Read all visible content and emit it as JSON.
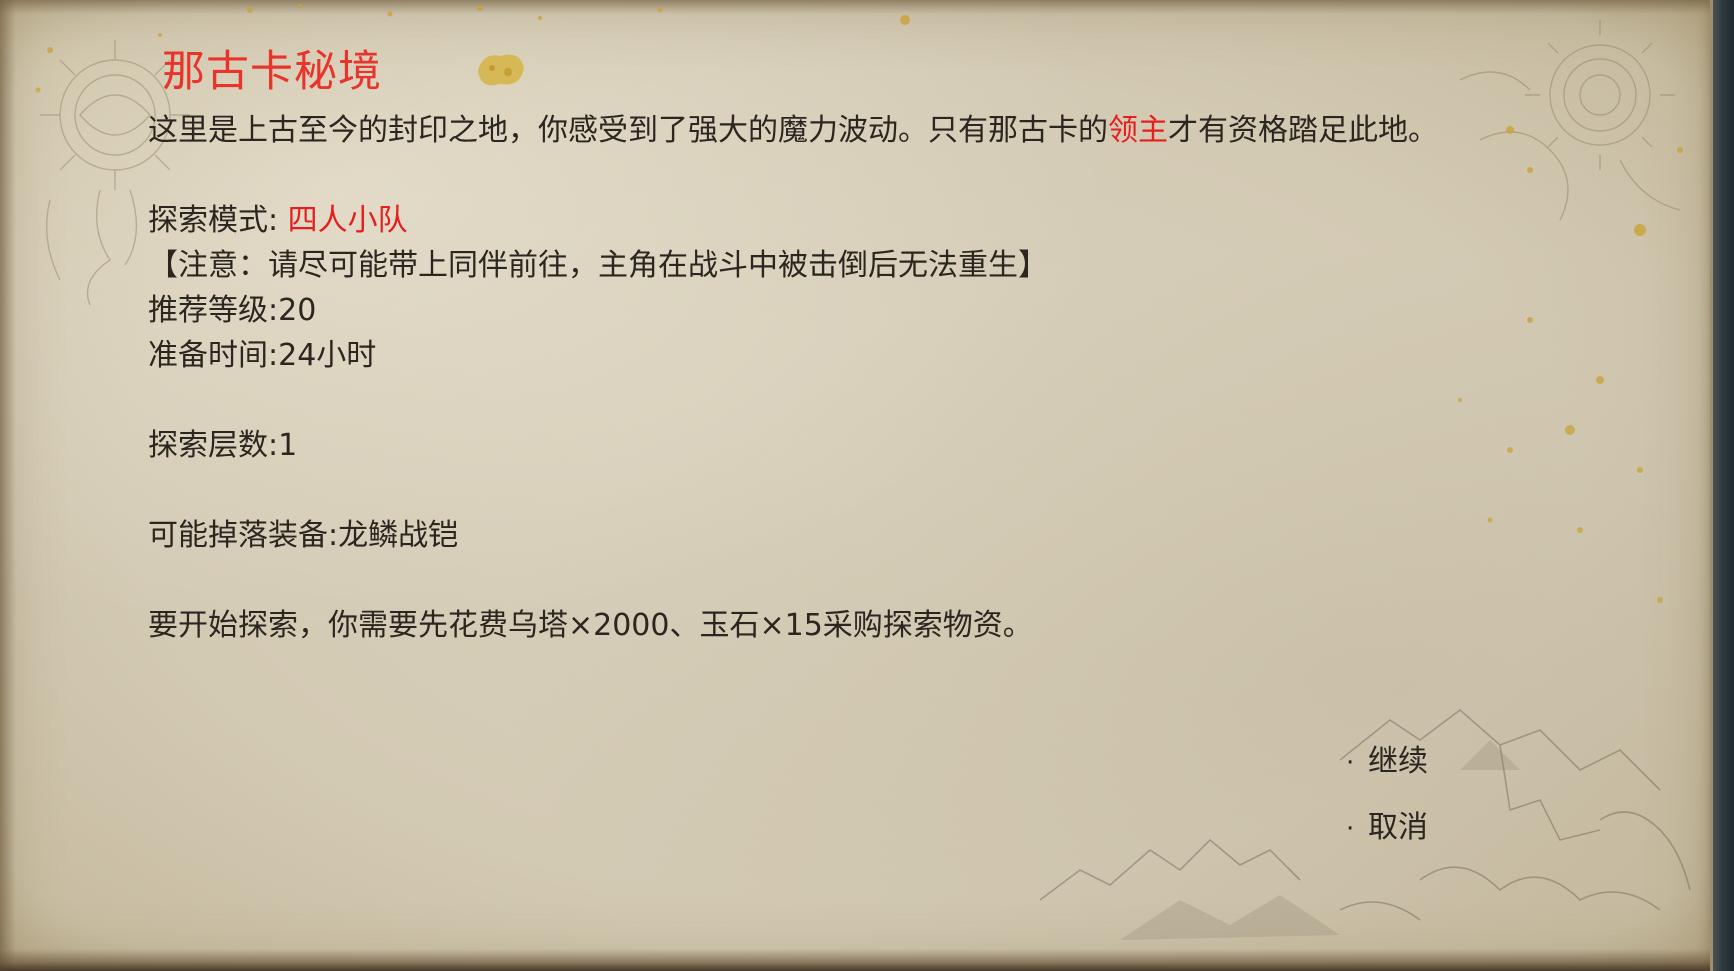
{
  "dialog": {
    "title": "那古卡秘境",
    "description": {
      "before": "这里是上古至今的封印之地，你感受到了强大的魔力波动。只有那古卡的",
      "highlight": "领主",
      "after": "才有资格踏足此地。"
    },
    "mode": {
      "label": "探索模式: ",
      "value": "四人小队"
    },
    "notice": "【注意：请尽可能带上同伴前往，主角在战斗中被击倒后无法重生】",
    "recommended_level": "推荐等级:20",
    "prep_time": "准备时间:24小时",
    "floors": "探索层数:1",
    "drops": "可能掉落装备:龙鳞战铠",
    "cost": "要开始探索，你需要先花费乌塔×2000、玉石×15采购探索物资。"
  },
  "options": {
    "bullet": "·",
    "continue_label": "继续",
    "cancel_label": "取消"
  },
  "colors": {
    "title": "#e8342b",
    "highlight": "#e61e1e",
    "text": "#2b2620",
    "parchment": "#d3cab4"
  }
}
